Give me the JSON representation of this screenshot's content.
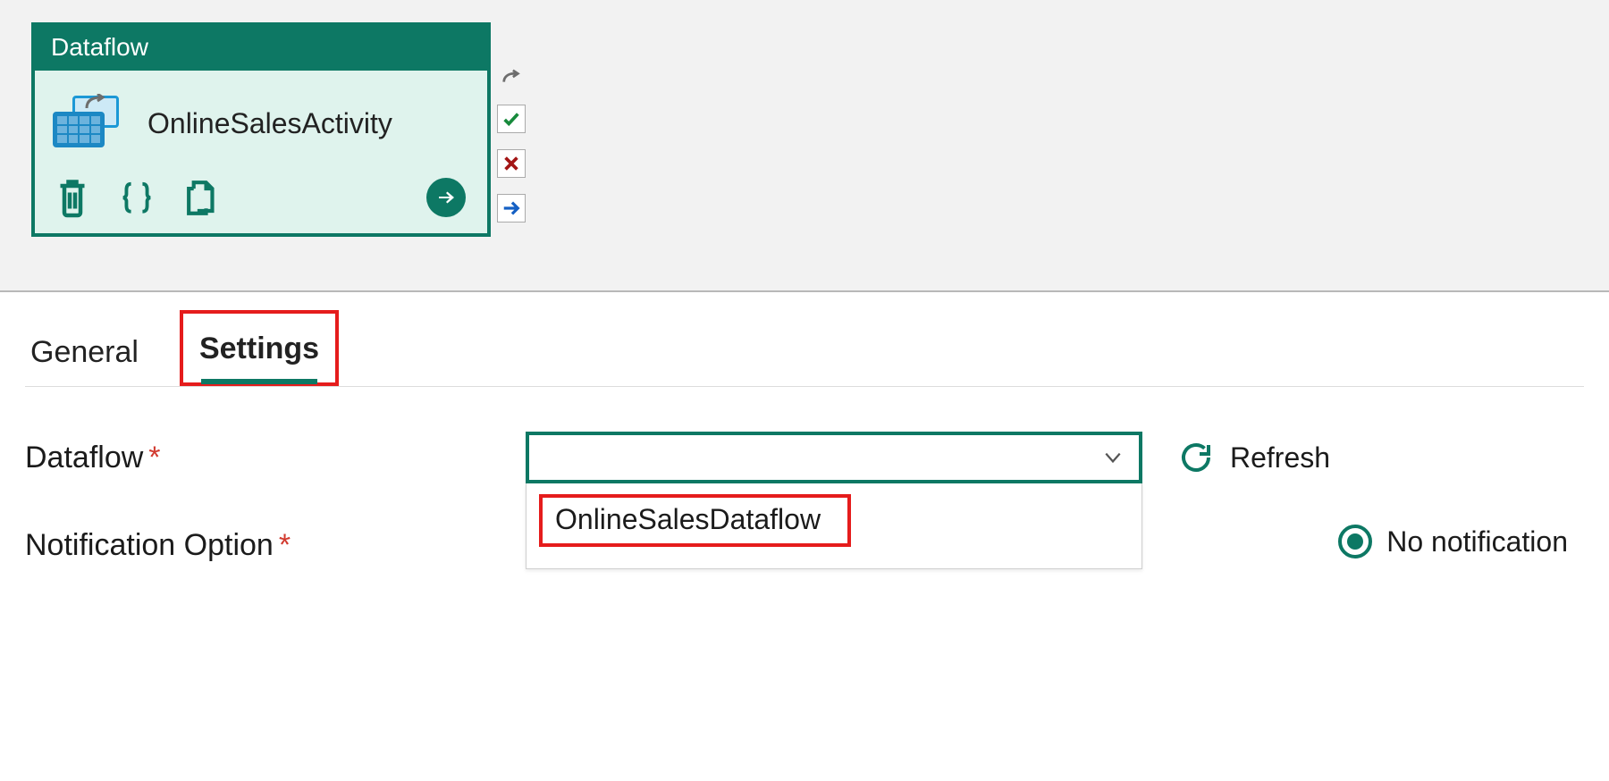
{
  "activity": {
    "type_label": "Dataflow",
    "name": "OnlineSalesActivity"
  },
  "tabs": {
    "general": "General",
    "settings": "Settings"
  },
  "form": {
    "dataflow_label": "Dataflow",
    "dataflow_value": "",
    "dropdown_option": "OnlineSalesDataflow",
    "refresh_label": "Refresh",
    "notification_label": "Notification Option",
    "no_notification_label": "No notification"
  }
}
